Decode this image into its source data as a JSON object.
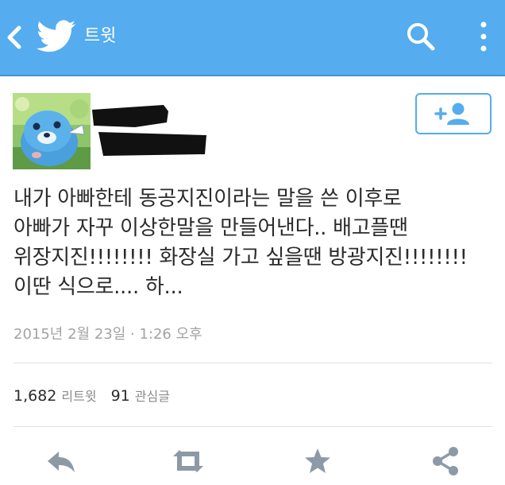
{
  "header": {
    "title": "트윗",
    "icons": [
      "back-arrow-icon",
      "twitter-bird-icon",
      "search-icon",
      "more-vert-icon"
    ],
    "background_color": "#55acee"
  },
  "tweet": {
    "text": "내가 아빠한테 동공지진이라는 말을 쓴 이후로\n아빠가 자꾸 이상한말을 만들어낸다.. 배고플땐\n위장지진!!!!!!!! 화장실 가고 싶을땐 방광지진!!!!!!!!\n이딴 식으로.... 하...",
    "timestamp": "2015년 2월 23일 · 1:26 오후",
    "follow_button_icon": "add-user-icon"
  },
  "stats": {
    "retweets_count": "1,682",
    "retweets_label": "리트윗",
    "favorites_count": "91",
    "favorites_label": "관심글"
  },
  "actions": {
    "icons": [
      "reply-icon",
      "retweet-icon",
      "favorite-star-icon",
      "share-icon"
    ],
    "icon_color": "#8d9aa6"
  }
}
